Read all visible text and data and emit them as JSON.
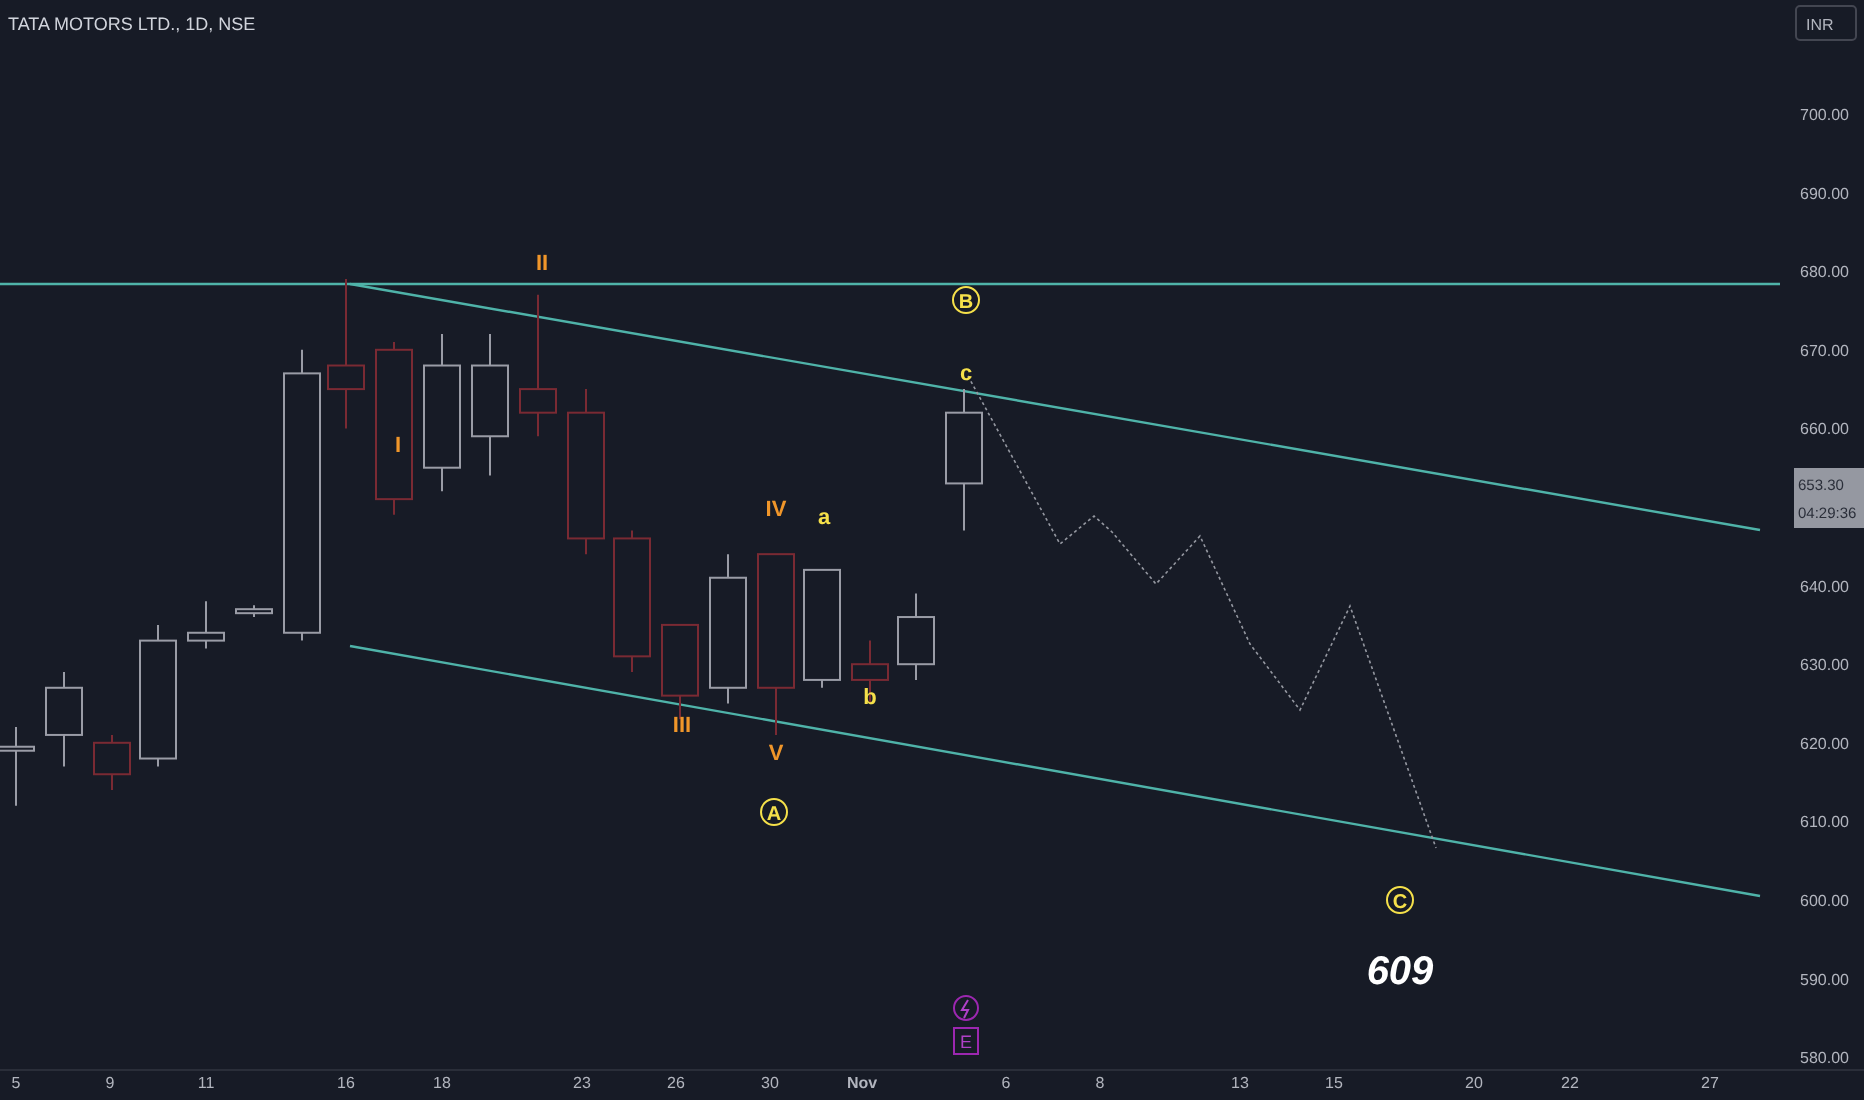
{
  "symbol_title": "TATA MOTORS LTD., 1D, NSE",
  "currency_button": "INR",
  "price_axis": [
    "700.00",
    "690.00",
    "680.00",
    "670.00",
    "660.00",
    "640.00",
    "630.00",
    "620.00",
    "610.00",
    "600.00",
    "590.00",
    "580.00"
  ],
  "price_tag": {
    "price": "653.30",
    "countdown": "04:29:36"
  },
  "time_axis": [
    "5",
    "9",
    "11",
    "16",
    "18",
    "23",
    "26",
    "30",
    "Nov",
    "6",
    "8",
    "13",
    "15",
    "20",
    "22",
    "27"
  ],
  "wave_labels": [
    {
      "text": "II",
      "kind": "plain",
      "color": "#f0962a"
    },
    {
      "text": "I",
      "kind": "plain",
      "color": "#f0962a"
    },
    {
      "text": "III",
      "kind": "plain",
      "color": "#f0962a"
    },
    {
      "text": "IV",
      "kind": "plain",
      "color": "#f0962a"
    },
    {
      "text": "V",
      "kind": "plain",
      "color": "#f0962a"
    },
    {
      "text": "a",
      "kind": "plain",
      "color": "#f5e04a"
    },
    {
      "text": "b",
      "kind": "plain",
      "color": "#f5e04a"
    },
    {
      "text": "c",
      "kind": "plain",
      "color": "#f5e04a"
    },
    {
      "text": "B",
      "kind": "circled",
      "color": "#f5e04a"
    },
    {
      "text": "A",
      "kind": "circled",
      "color": "#f5e04a"
    },
    {
      "text": "C",
      "kind": "circled",
      "color": "#f5e04a"
    }
  ],
  "target_note": "609",
  "earnings_marker": "E"
}
